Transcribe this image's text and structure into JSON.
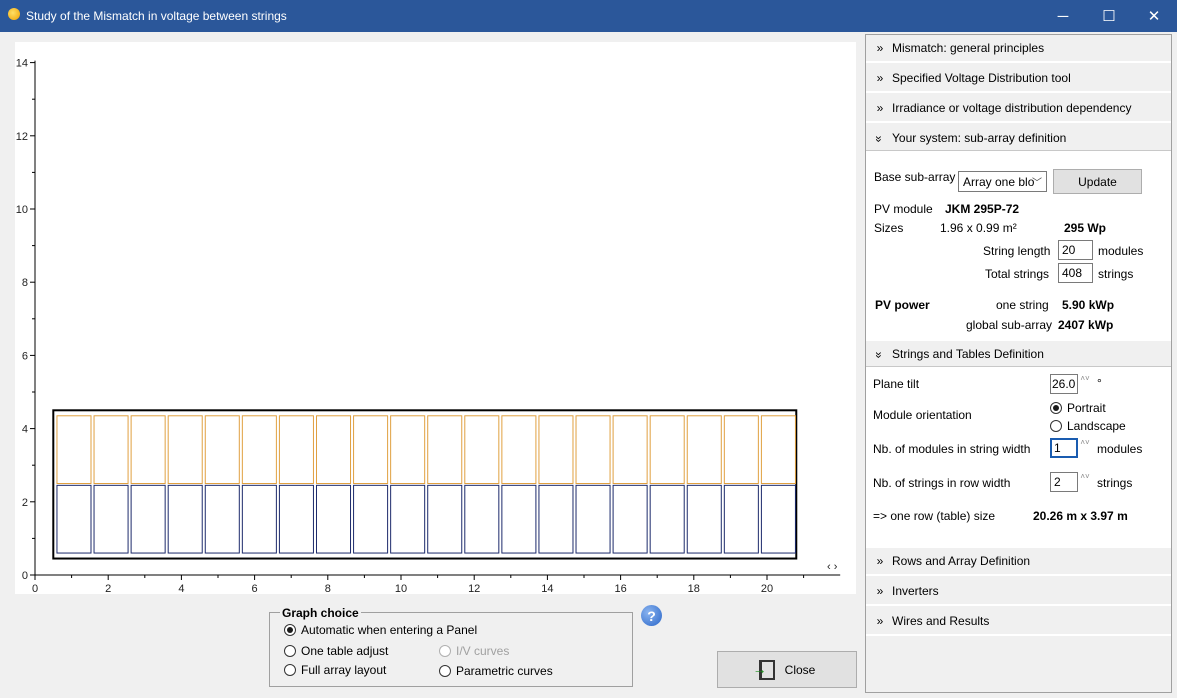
{
  "window": {
    "title": "Study of the Mismatch in voltage between strings",
    "minimize_glyph": "─",
    "maximize_glyph": "☐",
    "close_glyph": "✕"
  },
  "chart_data": {
    "type": "layout",
    "xlim": [
      0,
      22
    ],
    "ylim": [
      0,
      14
    ],
    "x_ticks": [
      "0",
      "2",
      "4",
      "6",
      "8",
      "10",
      "12",
      "14",
      "16",
      "18",
      "20"
    ],
    "y_ticks": [
      "0",
      "2",
      "4",
      "6",
      "8",
      "10",
      "12",
      "14"
    ],
    "table_frame": {
      "x0": 0.5,
      "x1": 20.8,
      "y0": 0.45,
      "y1": 4.5
    },
    "module_columns": 20,
    "module_width": 0.93,
    "module_pitch": 1.013,
    "first_module_x": 0.6,
    "rows": [
      {
        "name": "row-2",
        "y0": 2.5,
        "y1": 4.35,
        "color": "#e0a040"
      },
      {
        "name": "row-1",
        "y0": 0.6,
        "y1": 2.45,
        "color": "#1c2a6b"
      }
    ],
    "scroll_arrows": "‹ ›"
  },
  "graph_choice": {
    "legend": "Graph choice",
    "options": [
      {
        "label": "Automatic when entering a Panel",
        "checked": true,
        "disabled": false
      },
      {
        "label": "One table adjust",
        "checked": false,
        "disabled": false
      },
      {
        "label": "Full array layout",
        "checked": false,
        "disabled": false
      },
      {
        "label": "I/V curves",
        "checked": false,
        "disabled": true
      },
      {
        "label": "Parametric curves",
        "checked": false,
        "disabled": false
      }
    ]
  },
  "help_icon": "?",
  "close_button": "Close",
  "sections": {
    "mismatch": "Mismatch: general principles",
    "voltage_tool": "Specified Voltage Distribution tool",
    "irradiance": "Irradiance or voltage distribution dependency",
    "your_system": "Your system: sub-array definition",
    "strings_tables": "Strings and Tables Definition",
    "rows_array": "Rows and Array Definition",
    "inverters": "Inverters",
    "wires": "Wires and Results"
  },
  "chevrons": {
    "collapsed": "»",
    "expanded": "»"
  },
  "system": {
    "base_subarray_label": "Base sub-array",
    "base_subarray_value": "Array one blo",
    "update_button": "Update",
    "pv_module_label": "PV module",
    "pv_module_value": "JKM 295P-72",
    "sizes_label": "Sizes",
    "sizes_value": "1.96 x 0.99 m²",
    "power_value": "295 Wp",
    "string_length_label": "String length",
    "string_length_value": "20",
    "string_length_unit": "modules",
    "total_strings_label": "Total strings",
    "total_strings_value": "408",
    "total_strings_unit": "strings",
    "pv_power_label": "PV power",
    "one_string_label": "one string",
    "one_string_value": "5.90 kWp",
    "global_label": "global sub-array",
    "global_value": "2407 kWp"
  },
  "strings": {
    "plane_tilt_label": "Plane tilt",
    "plane_tilt_value": "26.0",
    "plane_tilt_unit": "°",
    "orientation_label": "Module orientation",
    "portrait": "Portrait",
    "landscape": "Landscape",
    "portrait_checked": true,
    "modules_width_label": "Nb. of modules in string width",
    "modules_width_value": "1",
    "modules_width_unit": "modules",
    "strings_row_label": "Nb. of strings in row width",
    "strings_row_value": "2",
    "strings_row_unit": "strings",
    "row_size_label": "=> one row (table) size",
    "row_size_value": "20.26 m x 3.97 m"
  },
  "spin_glyphs": "˄˅"
}
